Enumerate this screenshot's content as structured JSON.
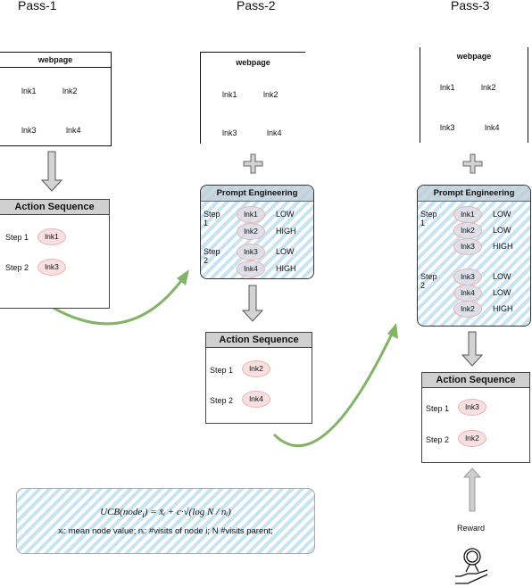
{
  "passes": {
    "p1": {
      "title": "Pass-1",
      "webpage": {
        "title": "webpage",
        "links": [
          "lnk1",
          "lnk2",
          "lnk3",
          "lnk4"
        ]
      },
      "action_sequence": {
        "title": "Action Sequence",
        "steps": [
          {
            "label": "Step 1",
            "link": "lnk1"
          },
          {
            "label": "Step 2",
            "link": "lnk3"
          }
        ]
      }
    },
    "p2": {
      "title": "Pass-2",
      "webpage": {
        "title": "webpage",
        "links": [
          "lnk1",
          "lnk2",
          "lnk3",
          "lnk4"
        ]
      },
      "prompt": {
        "title": "Prompt Engineering",
        "rows": [
          {
            "step": "Step 1",
            "link": "lnk1",
            "level": "LOW"
          },
          {
            "step": "",
            "link": "lnk2",
            "level": "HIGH"
          },
          {
            "step": "Step 2",
            "link": "lnk3",
            "level": "LOW"
          },
          {
            "step": "",
            "link": "lnk4",
            "level": "HIGH"
          }
        ]
      },
      "action_sequence": {
        "title": "Action Sequence",
        "steps": [
          {
            "label": "Step 1",
            "link": "lnk2"
          },
          {
            "label": "Step 2",
            "link": "lnk4"
          }
        ]
      }
    },
    "p3": {
      "title": "Pass-3",
      "webpage": {
        "title": "webpage",
        "links": [
          "lnk1",
          "lnk2",
          "lnk3",
          "lnk4"
        ]
      },
      "prompt": {
        "title": "Prompt Engineering",
        "rows": [
          {
            "step": "Step 1",
            "link": "lnk1",
            "level": "LOW"
          },
          {
            "step": "",
            "link": "lnk2",
            "level": "LOW"
          },
          {
            "step": "",
            "link": "lnk3",
            "level": "HIGH"
          },
          {
            "step": "Step 2",
            "link": "lnk3",
            "level": "LOW"
          },
          {
            "step": "",
            "link": "lnk4",
            "level": "LOW"
          },
          {
            "step": "",
            "link": "lnk2",
            "level": "HIGH"
          }
        ]
      },
      "action_sequence": {
        "title": "Action Sequence",
        "steps": [
          {
            "label": "Step 1",
            "link": "lnk3"
          },
          {
            "label": "Step 2",
            "link": "lnk2"
          }
        ]
      },
      "reward_label": "Reward"
    }
  },
  "ucb": {
    "formula_lhs": "UCB(node",
    "formula_sub": "i",
    "formula_rhs": ") = x̄ᵢ + c·√(log N / nᵢ)",
    "legend": "xᵢ: mean node value; nᵢ: #visits of node i; N #visits parent;"
  },
  "colors": {
    "arrow_green": "#82b366",
    "hatch": "#c8e3f2",
    "header_grey": "#d0d0d0",
    "pill": "#f8e0e0"
  },
  "icons": [
    "plus-icon",
    "down-arrow-icon",
    "up-arrow-icon",
    "reward-hand-medal-icon"
  ]
}
